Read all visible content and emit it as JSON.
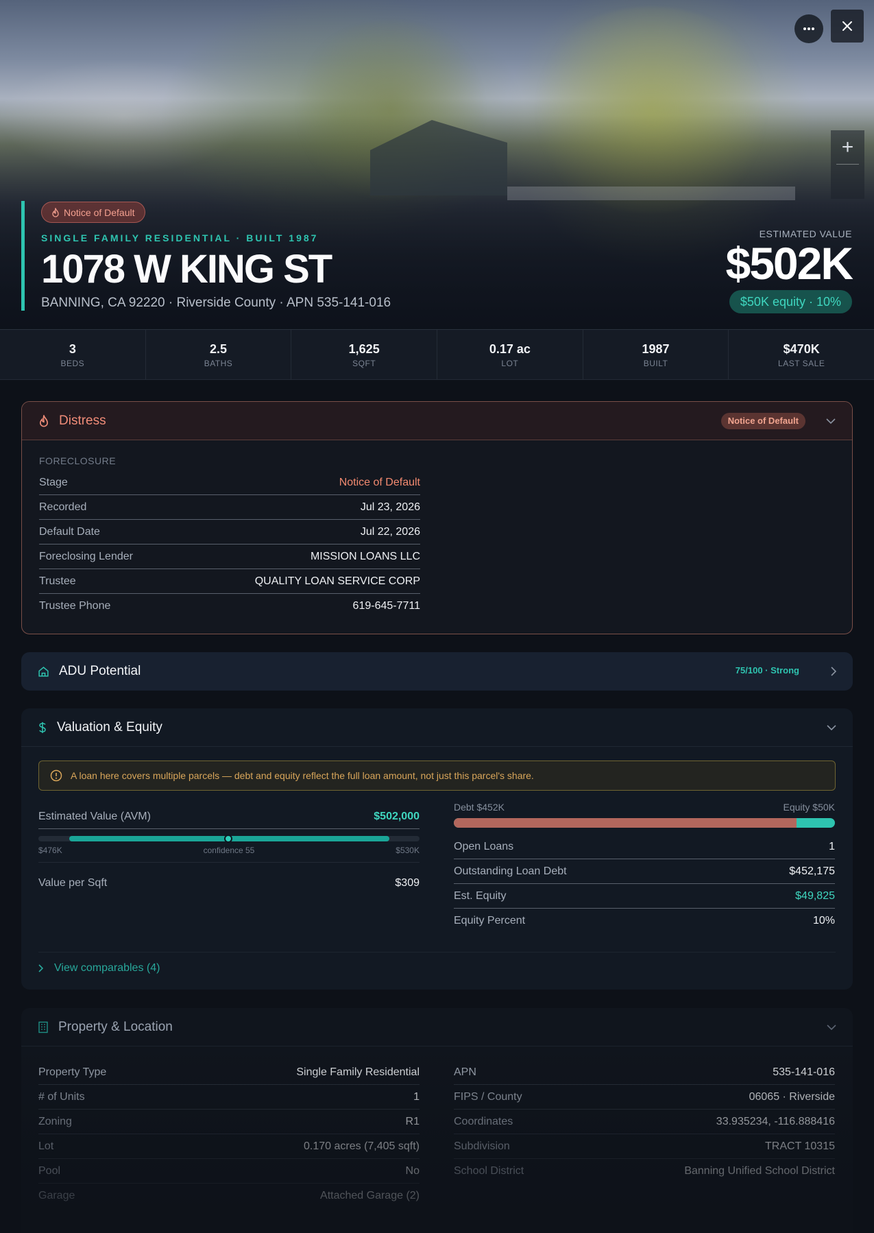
{
  "hero": {
    "distress_badge": "Notice of Default",
    "subtitle": "SINGLE FAMILY RESIDENTIAL · BUILT 1987",
    "address": "1078 W KING ST",
    "location_line": "BANNING, CA 92220 · Riverside County · APN 535-141-016",
    "estimated_value_label": "ESTIMATED VALUE",
    "estimated_value": "$502K",
    "equity_pill": "$50K equity · 10%"
  },
  "stats": [
    {
      "value": "3",
      "label": "BEDS"
    },
    {
      "value": "2.5",
      "label": "BATHS"
    },
    {
      "value": "1,625",
      "label": "SQFT"
    },
    {
      "value": "0.17 ac",
      "label": "LOT"
    },
    {
      "value": "1987",
      "label": "BUILT"
    },
    {
      "value": "$470K",
      "label": "LAST SALE"
    }
  ],
  "distress": {
    "title": "Distress",
    "badge": "Notice of Default",
    "section_label": "FORECLOSURE",
    "rows": [
      {
        "key": "Stage",
        "value": "Notice of Default"
      },
      {
        "key": "Recorded",
        "value": "Jul 23, 2026"
      },
      {
        "key": "Default Date",
        "value": "Jul 22, 2026"
      },
      {
        "key": "Foreclosing Lender",
        "value": "MISSION LOANS LLC"
      },
      {
        "key": "Trustee",
        "value": "QUALITY LOAN SERVICE CORP"
      },
      {
        "key": "Trustee Phone",
        "value": "619-645-7711"
      }
    ]
  },
  "adu": {
    "title": "ADU Potential",
    "score": "75/100 · Strong"
  },
  "valuation": {
    "title": "Valuation & Equity",
    "warning": "A loan here covers multiple parcels — debt and equity reflect the full loan amount, not just this parcel's share.",
    "avm_label": "Estimated Value (AVM)",
    "avm_value": "$502,000",
    "avm_low": "$476K",
    "avm_confidence": "confidence 55",
    "avm_high": "$530K",
    "value_per_sqft_label": "Value per Sqft",
    "value_per_sqft": "$309",
    "debt_label": "Debt $452K",
    "equity_label": "Equity $50K",
    "debt_fraction": 0.9,
    "loan_rows": [
      {
        "key": "Open Loans",
        "value": "1"
      },
      {
        "key": "Outstanding Loan Debt",
        "value": "$452,175"
      },
      {
        "key": "Est. Equity",
        "value": "$49,825"
      },
      {
        "key": "Equity Percent",
        "value": "10%"
      }
    ],
    "comparables_link": "View comparables (4)"
  },
  "property": {
    "title": "Property & Location",
    "left_rows": [
      {
        "key": "Property Type",
        "value": "Single Family Residential"
      },
      {
        "key": "# of Units",
        "value": "1"
      },
      {
        "key": "Zoning",
        "value": "R1"
      },
      {
        "key": "Lot",
        "value": "0.170 acres (7,405 sqft)"
      },
      {
        "key": "Pool",
        "value": "No"
      },
      {
        "key": "Garage",
        "value": "Attached Garage (2)"
      }
    ],
    "right_rows": [
      {
        "key": "APN",
        "value": "535-141-016"
      },
      {
        "key": "FIPS / County",
        "value": "06065 · Riverside"
      },
      {
        "key": "Coordinates",
        "value": "33.935234, -116.888416"
      },
      {
        "key": "Subdivision",
        "value": "TRACT 10315"
      },
      {
        "key": "School District",
        "value": "Banning Unified School District"
      }
    ]
  },
  "colors": {
    "accent": "#2ec4b0",
    "distress": "#f08c78",
    "debt": "#b3675d",
    "background": "#0d1118"
  }
}
